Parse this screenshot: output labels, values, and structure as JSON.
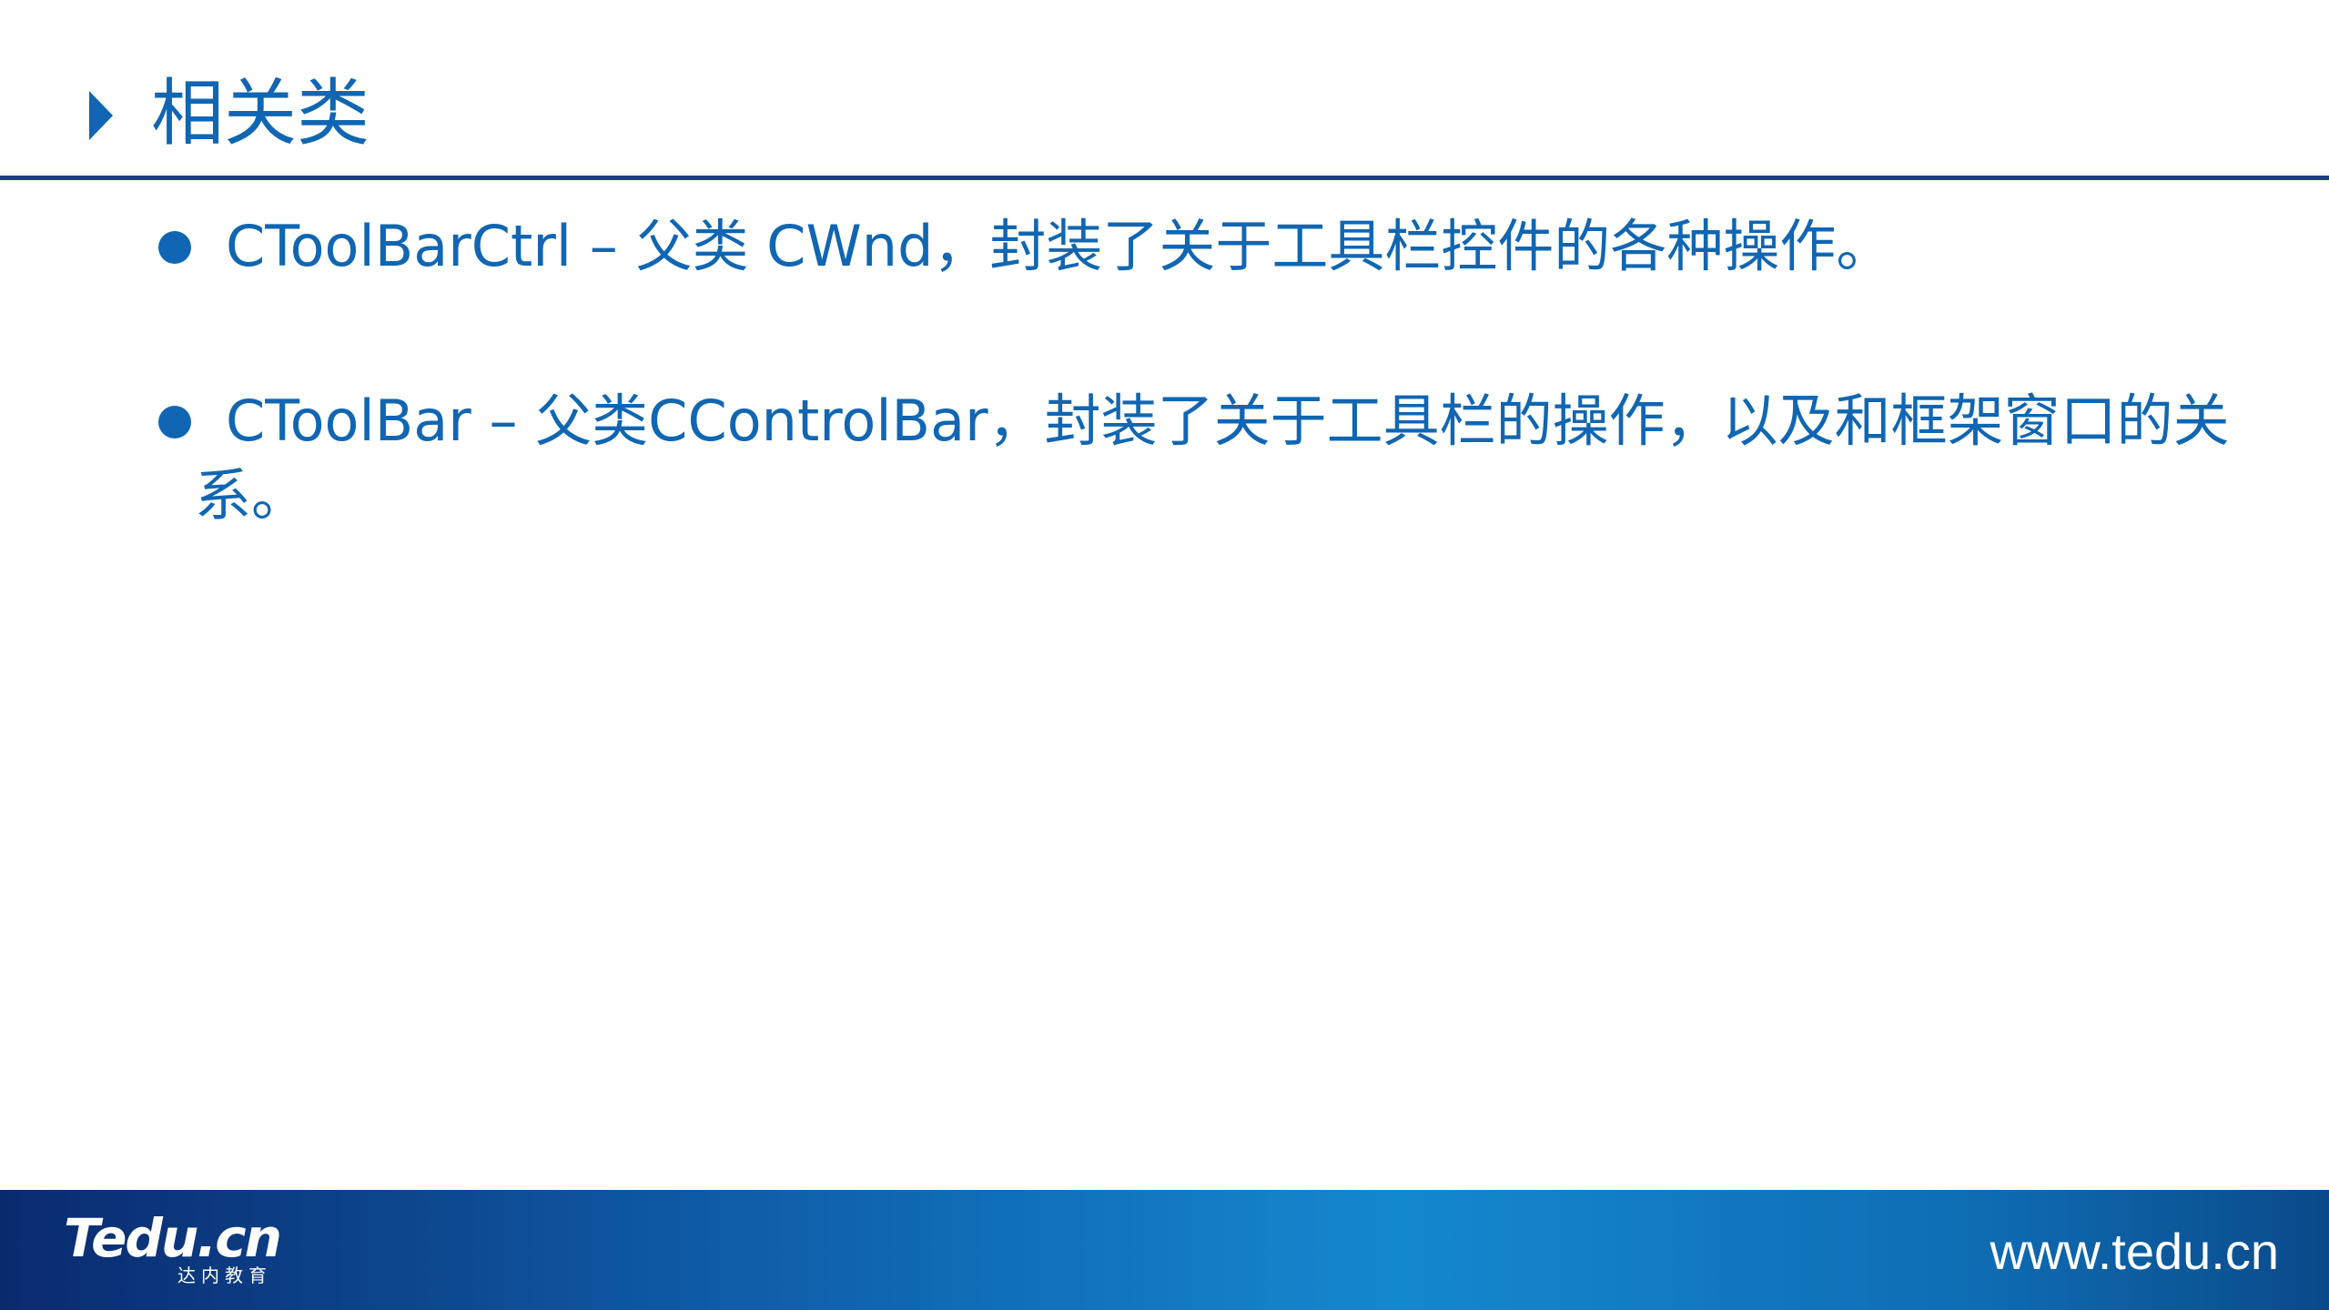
{
  "slide": {
    "title": "相关类"
  },
  "bullets": [
    {
      "line1": "CToolBarCtrl – 父类 CWnd，封装了关于工具栏控件的各种操作。",
      "line2": ""
    },
    {
      "line1": "CToolBar – 父类CControlBar，封装了关于工具栏的操作，以及和框架窗口的关",
      "line2": "系。"
    }
  ],
  "footer": {
    "logo_text": "Tedu.cn",
    "logo_subtext": "达内教育",
    "url": "www.tedu.cn"
  },
  "colors": {
    "accent": "#1066b2",
    "rule": "#1c3f86",
    "footer_dark": "#0a2a6e",
    "footer_light": "#1488cf"
  }
}
